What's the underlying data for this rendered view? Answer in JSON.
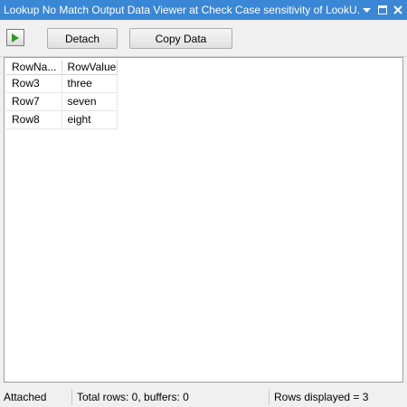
{
  "window": {
    "title": "Lookup No Match Output Data Viewer at Check Case sensitivity of LookU...",
    "dropdown_icon": "dropdown-arrow-icon",
    "pin_icon": "maximize-icon",
    "close_icon": "close-icon"
  },
  "toolbar": {
    "play_icon": "play-icon",
    "detach_label": "Detach",
    "copy_label": "Copy Data"
  },
  "grid": {
    "columns": [
      "RowNa...",
      "RowValue"
    ],
    "rows": [
      [
        "Row3",
        "three"
      ],
      [
        "Row7",
        "seven"
      ],
      [
        "Row8",
        "eight"
      ]
    ]
  },
  "status": {
    "state": "Attached",
    "totals": "Total rows: 0, buffers: 0",
    "displayed": "Rows displayed = 3"
  },
  "colors": {
    "titlebar": "#3a87d6",
    "play_green": "#2e9a2e"
  }
}
